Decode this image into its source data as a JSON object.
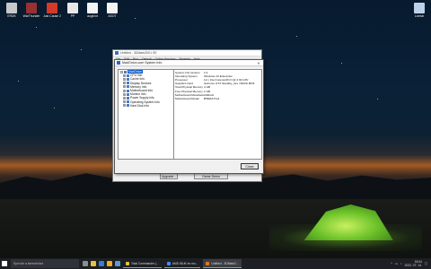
{
  "desktop": {
    "icons": [
      {
        "label": "ERDK",
        "color": "#c9c9c9"
      },
      {
        "label": "WarThunder",
        "color": "#9a3030"
      },
      {
        "label": "Just Cause 2",
        "color": "#d43a2a"
      },
      {
        "label": "PP",
        "color": "#e8e8e8"
      },
      {
        "label": "augit.txt",
        "color": "#f4f4f4"
      },
      {
        "label": "ASOT",
        "color": "#f4f4f4"
      },
      {
        "label": "Lomtár",
        "color": "#bcd2ea"
      }
    ]
  },
  "background_window": {
    "title": "Untitled - 3DMark2001 SE",
    "menu": [
      "File",
      "Edit",
      "Run",
      "Default",
      "Online Services",
      "Register",
      "Help"
    ],
    "upgrade_button": "Upgrade...",
    "game_demo_button": "Game Demo"
  },
  "dialog": {
    "title": "MadOnion.com System Info",
    "tree": {
      "root": "MadOnion",
      "items": [
        "CPU Info",
        "Cache Info",
        "Display Devices",
        "Memory Info",
        "Motherboard Info",
        "Monitor Info",
        "Power Supply Info",
        "Operating System Info",
        "Hard Disk Info"
      ]
    },
    "info_rows": [
      {
        "key": "System Info Version",
        "value": "2.2"
      },
      {
        "key": "Operating System",
        "value": "Windows 10 Enterprise"
      },
      {
        "key": "Processor",
        "value": "12 x Intel Celeron(R) N @ 2.90 GHz"
      },
      {
        "key": "Graphics Card",
        "value": "GeForce GTX Standby_dev 740/2S MHZ"
      },
      {
        "key": "Total Physical Memory",
        "value": "4 GB"
      },
      {
        "key": "Free Physical Memory",
        "value": "2 GB"
      },
      {
        "key": "Motherboard Manufacturer",
        "value": "ASRock"
      },
      {
        "key": "Motherboard Model",
        "value": "B560M Pro4"
      }
    ],
    "close_button": "Close"
  },
  "taskbar": {
    "search_placeholder": "Írjon ide a kereséshez",
    "apps": [
      {
        "label": "Total Commander (...",
        "color": "#e8c23a"
      },
      {
        "label": "AMD 68-iK es mo...",
        "color": "#4a8df0"
      },
      {
        "label": "Untitled - 3DMark2...",
        "color": "#e07a18"
      }
    ],
    "time": "15:04",
    "date": "2022. 07. 14."
  }
}
